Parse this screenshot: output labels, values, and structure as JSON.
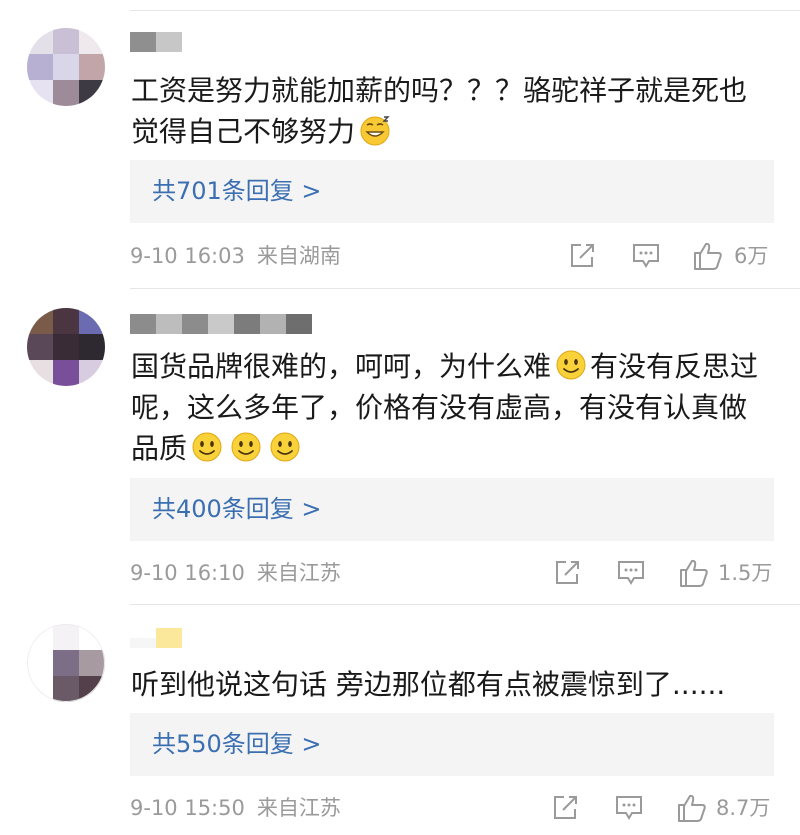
{
  "comments": [
    {
      "text_1": "工资是努力就能加薪的吗？？？骆驼祥子就是死也觉得自己不够努力",
      "emoji_1": "grinning-sweat-emoji",
      "replies": "共701条回复 >",
      "date": "9-10 16:03",
      "location": "来自湖南",
      "likes": "6万"
    },
    {
      "text_1": "国货品牌很难的，呵呵，为什么难",
      "text_2": "有没有反思过呢，这么多年了，价格有没有虚高，有没有认真做品质",
      "emoji_1": "smile-emoji",
      "emoji_2": "smile-emoji",
      "replies": "共400条回复 >",
      "date": "9-10 16:10",
      "location": "来自江苏",
      "likes": "1.5万"
    },
    {
      "text_1": "听到他说这句话 旁边那位都有点被震惊到了......",
      "replies": "共550条回复 >",
      "date": "9-10 15:50",
      "location": "来自江苏",
      "likes": "8.7万"
    }
  ],
  "icons": {
    "share": "share-icon",
    "comment": "comment-icon",
    "like": "thumb-up-icon"
  }
}
